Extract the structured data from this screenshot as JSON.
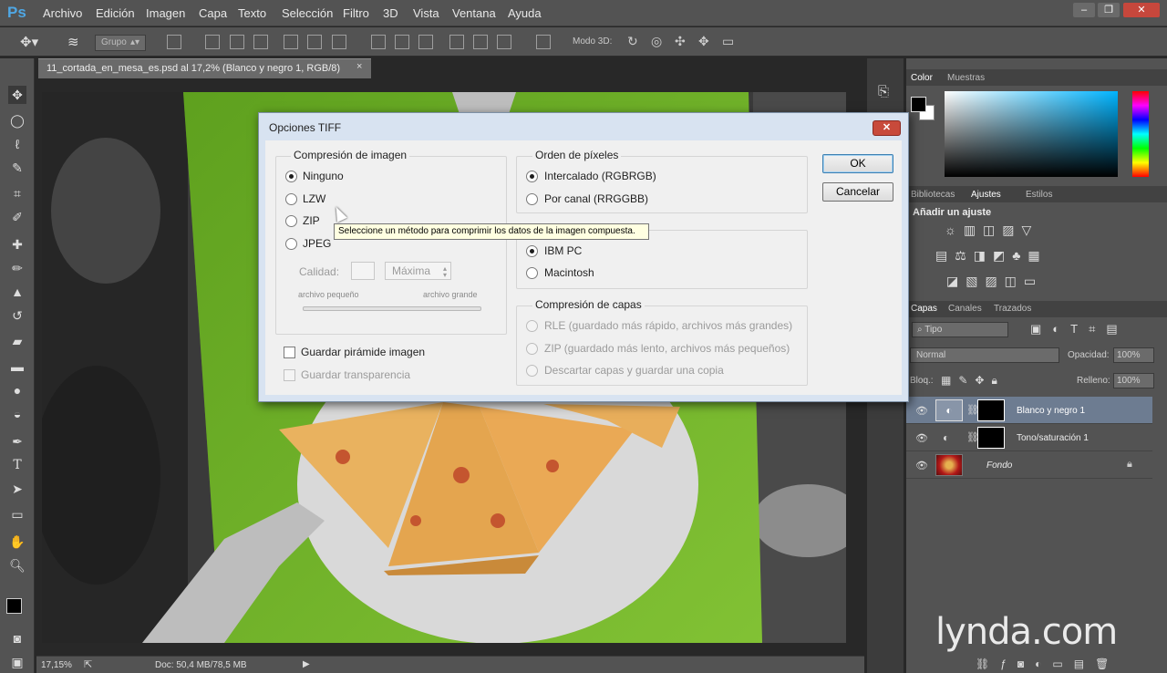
{
  "menubar": {
    "logo": "Ps",
    "items": [
      "Archivo",
      "Edición",
      "Imagen",
      "Capa",
      "Texto",
      "Selección",
      "Filtro",
      "3D",
      "Vista",
      "Ventana",
      "Ayuda"
    ],
    "window_buttons": [
      "–",
      "❐",
      "✕"
    ]
  },
  "optionsbar": {
    "group_select": "Grupo",
    "mode3d_label": "Modo 3D:"
  },
  "document": {
    "tab_title": "11_cortada_en_mesa_es.psd al 17,2% (Blanco y negro 1, RGB/8)",
    "tab_close": "×"
  },
  "statusbar": {
    "zoom": "17,15%",
    "doc_info": "Doc: 50,4 MB/78,5 MB"
  },
  "tooltip": "Seleccione un método para comprimir los datos de la imagen compuesta.",
  "dialog": {
    "title": "Opciones TIFF",
    "close": "✕",
    "ok": "OK",
    "cancel": "Cancelar",
    "image_compression": {
      "label": "Compresión de imagen",
      "options": [
        "Ninguno",
        "LZW",
        "ZIP",
        "JPEG"
      ],
      "selected": "Ninguno",
      "quality_label": "Calidad:",
      "quality_value": "",
      "quality_select": "Máxima",
      "small_file": "archivo pequeño",
      "large_file": "archivo grande"
    },
    "pixel_order": {
      "label": "Orden de píxeles",
      "options": [
        "Intercalado (RGBRGB)",
        "Por canal (RRGGBB)"
      ],
      "selected": "Intercalado (RGBRGB)"
    },
    "byte_order": {
      "label": "",
      "options": [
        "IBM PC",
        "Macintosh"
      ],
      "selected": "IBM PC"
    },
    "layer_compression": {
      "label": "Compresión de capas",
      "options": [
        "RLE (guardado más rápido, archivos más grandes)",
        "ZIP (guardado más lento, archivos más pequeños)",
        "Descartar capas y guardar una copia"
      ]
    },
    "checkboxes": {
      "pyramid": "Guardar pirámide imagen",
      "transparency": "Guardar transparencia"
    }
  },
  "panels": {
    "color_tabs": [
      "Color",
      "Muestras"
    ],
    "adjust_tabs": [
      "Bibliotecas",
      "Ajustes",
      "Estilos"
    ],
    "add_adjust": "Añadir un ajuste",
    "layers_tabs": [
      "Capas",
      "Canales",
      "Trazados"
    ],
    "filter_type": "Tipo",
    "blend_mode": "Normal",
    "opacity_label": "Opacidad:",
    "opacity_value": "100%",
    "lock_label": "Bloq.:",
    "fill_label": "Relleno:",
    "fill_value": "100%",
    "layers": [
      {
        "name": "Blanco y negro 1",
        "selected": true
      },
      {
        "name": "Tono/saturación 1",
        "selected": false
      },
      {
        "name": "Fondo",
        "selected": false
      }
    ]
  },
  "watermark": "lynda.com",
  "colors": {
    "ps_dark": "#535353",
    "dialog_frame": "#d8e3f1",
    "green_table": "#6fb526",
    "selected_layer": "#6d7c91"
  }
}
